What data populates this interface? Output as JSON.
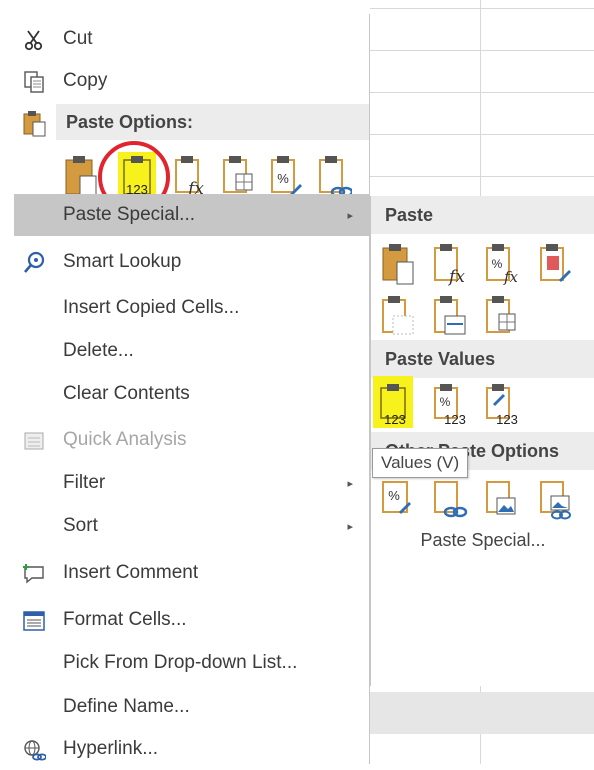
{
  "menu": {
    "cut": "Cut",
    "copy": "Copy",
    "paste_options_header": "Paste Options:",
    "paste_special": "Paste Special...",
    "smart_lookup": "Smart Lookup",
    "insert_copied_cells": "Insert Copied Cells...",
    "delete": "Delete...",
    "clear_contents": "Clear Contents",
    "quick_analysis": "Quick Analysis",
    "filter": "Filter",
    "sort": "Sort",
    "insert_comment": "Insert Comment",
    "format_cells": "Format Cells...",
    "pick_from_dropdown": "Pick From Drop-down List...",
    "define_name": "Define Name...",
    "hyperlink": "Hyperlink..."
  },
  "paste_icons": {
    "values_text": "123",
    "formula_text": "fx",
    "percent_text": "%"
  },
  "submenu": {
    "paste_header": "Paste",
    "paste_values_header": "Paste Values",
    "other_paste_options_header": "Other Paste Options",
    "paste_special_link": "Paste Special...",
    "tooltip": "Values (V)"
  },
  "colors": {
    "highlight_yellow": "#f7f21b",
    "circle_red": "#e0252e",
    "clipboard_orange": "#d39a3f",
    "menu_hover": "#c6c6c6",
    "section_gray": "#ececec"
  }
}
